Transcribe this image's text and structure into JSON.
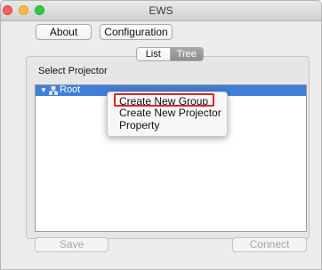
{
  "window": {
    "title": "EWS"
  },
  "toolbar": {
    "about_label": "About",
    "configuration_label": "Configuration"
  },
  "view_switch": {
    "options": [
      "List",
      "Tree"
    ],
    "selected": "Tree"
  },
  "projector_panel": {
    "heading": "Select Projector",
    "tree": {
      "root_label": "Root",
      "root_icon": "network-tree-icon",
      "expanded": true,
      "selected": true
    }
  },
  "context_menu": {
    "items": [
      "Create New Group",
      "Create New Projector",
      "Property"
    ],
    "highlighted": "Create New Group"
  },
  "footer": {
    "save_label": "Save",
    "connect_label": "Connect"
  },
  "colors": {
    "selection": "#3f7fd8",
    "highlight_box": "#d9222c",
    "segment_selected": "#9a9a9a"
  }
}
